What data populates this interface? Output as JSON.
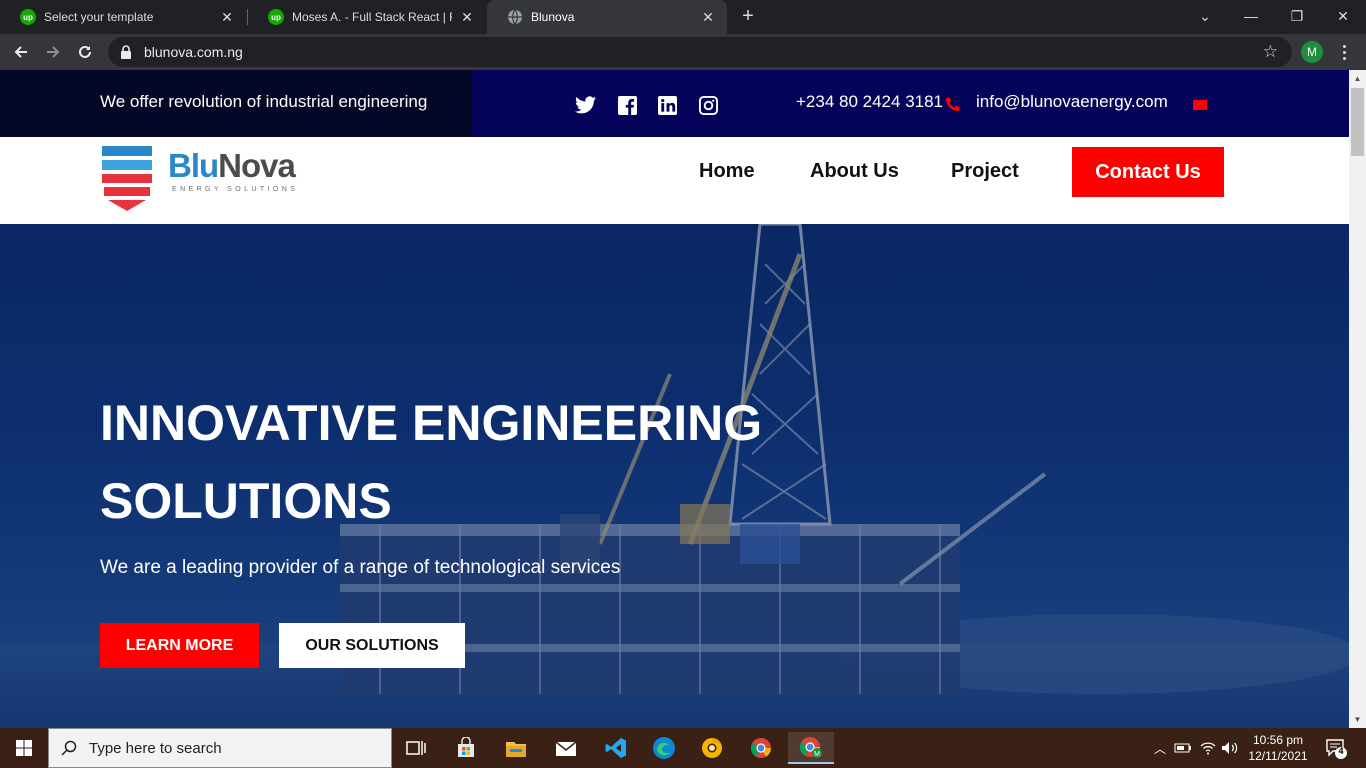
{
  "browser": {
    "tabs": [
      {
        "title": "Select your template",
        "icon": "upwork-icon"
      },
      {
        "title": "Moses A. - Full Stack React | Fireb",
        "icon": "upwork-icon"
      },
      {
        "title": "Blunova",
        "icon": "globe-icon",
        "active": true
      }
    ],
    "url": "blunova.com.ng",
    "profile_initial": "M"
  },
  "site": {
    "topbar": {
      "tagline": "We offer revolution of industrial engineering",
      "phone": "+234 80 2424 3181",
      "email": "info@blunovaenergy.com",
      "socials": [
        "twitter-icon",
        "facebook-icon",
        "linkedin-icon",
        "instagram-icon"
      ]
    },
    "logo": {
      "blu": "Blu",
      "nova": "Nova",
      "sub": "ENERGY SOLUTIONS"
    },
    "nav": {
      "home": "Home",
      "about": "About Us",
      "project": "Project",
      "contact": "Contact Us"
    },
    "hero": {
      "title_line1": "INNOVATIVE ENGINEERING",
      "title_line2": "SOLUTIONS",
      "subtitle": "We are a leading provider of a range of technological services",
      "learn_more": "LEARN MORE",
      "our_solutions": "OUR SOLUTIONS"
    }
  },
  "taskbar": {
    "search_placeholder": "Type here to search",
    "time": "10:56 pm",
    "date": "12/11/2021",
    "notification_count": "4"
  },
  "colors": {
    "accent_red": "#ff0000",
    "topbar_navy": "#06045a",
    "brand_blue": "#2a87c8"
  }
}
